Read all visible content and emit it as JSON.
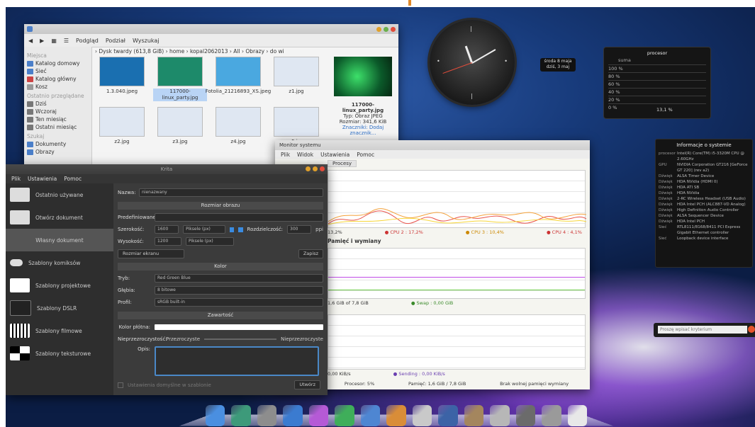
{
  "desktop": {
    "accent": "#e08a2a"
  },
  "file_manager": {
    "toolbar": [
      "Wstecz",
      "Dalej",
      "Podgląd",
      "Podział",
      "Wyszukaj"
    ],
    "sidebar": {
      "places_title": "Miejsca",
      "places": [
        "Katalog domowy",
        "Sieć",
        "Katalog główny",
        "Kosz"
      ],
      "recent_title": "Ostatnio przeglądane",
      "recent": [
        "Dziś",
        "Wczoraj",
        "Ten miesiąc",
        "Ostatni miesiąc"
      ],
      "search_title": "Szukaj",
      "search": [
        "Dokumenty",
        "Obrazy"
      ]
    },
    "breadcrumb": "› Dysk twardy (613,8 GiB) › home › kopal2062013 › All › Obrazy › do wi",
    "thumbs": [
      {
        "name": "1.3.040.jpeg",
        "color": "#1a6fb0"
      },
      {
        "name": "117000-linux_party.jpg",
        "color": "#1d8a6a",
        "selected": true
      },
      {
        "name": "Fotolia_21216893_XS.jpeg",
        "color": "#4aa8e0"
      },
      {
        "name": "z1.jpg",
        "color": "#dfe7f2"
      },
      {
        "name": "z2.jpg",
        "color": "#dfe7f2"
      },
      {
        "name": "z3.jpg",
        "color": "#dfe7f2"
      },
      {
        "name": "z4.jpg",
        "color": "#dfe7f2"
      },
      {
        "name": "z5.jpg",
        "color": "#dfe7f2"
      }
    ],
    "preview": {
      "filename": "117000-linux_party.jpg",
      "type": "Typ: Obraz JPEG",
      "size": "Rozmiar: 341,6 KiB",
      "tag": "Znaczniki: Dodaj znacznik..."
    }
  },
  "clock": {
    "label_line1": "środa 8 maja",
    "label_line2": "dziś, 3 maj"
  },
  "cpu_widget": {
    "title": "procesor",
    "header": "suma",
    "rows": [
      "100 %",
      "80 %",
      "60 %",
      "40 %",
      "20 %",
      "0 %"
    ],
    "value": "13,1 %"
  },
  "sysinfo": {
    "title": "Informacje o systemie",
    "lines": [
      {
        "k": "procesor",
        "v": "Intel(R) Core(TM) i5-3320M CPU @ 2.60GHz"
      },
      {
        "k": "GPU",
        "v": "NVIDIA Corporation GT216 [GeForce GT 220] (rev a2)"
      },
      {
        "k": "Dźwięk",
        "v": "ALSA Timer Device"
      },
      {
        "k": "Dźwięk",
        "v": "HDA NVidia (HDMI 0)"
      },
      {
        "k": "Dźwięk",
        "v": "HDA ATI SB"
      },
      {
        "k": "Dźwięk",
        "v": "HDA NVidia"
      },
      {
        "k": "Dźwięk",
        "v": "2-RC Wireless Headset (USB Audio)"
      },
      {
        "k": "Dźwięk",
        "v": "HDA Intel PCH (ALC887-VD Analog)"
      },
      {
        "k": "Dźwięk",
        "v": "High Definition Audio Controller"
      },
      {
        "k": "Dźwięk",
        "v": "ALSA Sequencer Device"
      },
      {
        "k": "Dźwięk",
        "v": "HDA Intel PCH"
      },
      {
        "k": "Sieć",
        "v": "RTL8111/8168/8411 PCI Express Gigabit Ethernet controller"
      },
      {
        "k": "Sieć",
        "v": "Loopback device interface"
      }
    ]
  },
  "search_widget": {
    "placeholder": "Proszę wpisać kryterium"
  },
  "monitor": {
    "title": "Monitor systemu",
    "menu": [
      "Plik",
      "Widok",
      "Ustawienia",
      "Pomoc"
    ],
    "tab": "Procesy",
    "cpu_legend": [
      "13,2%",
      "● CPU 2 : 17,2%",
      "● CPU 3 : 10,4%",
      "● CPU 4 : 4,1%"
    ],
    "mem_title": "Pamięć i wymiany",
    "mem_legend": [
      "1,6 GiB of 7,8 GiB",
      "● Swap : 0,00 GiB"
    ],
    "net_legend": [
      "0,00 KiB/s",
      "● Sending : 0,00 KiB/s"
    ],
    "status": [
      "Procesor: 5%",
      "Pamięć: 1,6 GiB / 7,8 GiB",
      "Brak wolnej pamięci wymiany"
    ],
    "colors": {
      "cpu1": "#e8524a",
      "cpu2": "#f4a13a",
      "cpu3": "#f7d63a",
      "mem": "#c04ce6",
      "swap": "#6acb44",
      "net": "#8a5fd0"
    }
  },
  "dialog": {
    "title": "Krita",
    "menu": [
      "Plik",
      "Ustawienia",
      "Pomoc"
    ],
    "sidebar": [
      "Ostatnio używane",
      "Otwórz dokument",
      "Własny dokument",
      "Szablony komiksów",
      "Szablony projektowe",
      "Szablony DSLR",
      "Szablony filmowe",
      "Szablony teksturowe"
    ],
    "name_label": "Nazwa:",
    "name_value": "nienazwany",
    "size_section": "Rozmiar obrazu",
    "predefined": "Predefiniowane:",
    "width_label": "Szerokość:",
    "width_value": "1600",
    "height_label": "Wysokość:",
    "height_value": "1200",
    "unit": "Piksele (px)",
    "resolution_label": "Rozdzielczość:",
    "resolution_value": "300",
    "ppi": "ppi",
    "screen_size": "Rozmiar ekranu",
    "save_small": "Zapisz",
    "color_section": "Kolor",
    "mode_label": "Tryb:",
    "mode_value": "Red Green Blue",
    "depth_label": "Głębia:",
    "depth_value": "8 bitowe",
    "profile_label": "Profil:",
    "profile_value": "sRGB built-in",
    "content_section": "Zawartość",
    "bg_label": "Kolor płótna:",
    "opacity_label": "Nieprzezroczystość:",
    "opacity_left": "Przezroczyste",
    "opacity_right": "Nieprzezroczyste",
    "desc_label": "Opis:",
    "default_check": "Ustawienia domyślne w szablonie",
    "create_button": "Utwórz"
  },
  "dock": [
    {
      "name": "finder-icon",
      "color": "#4a8fe0"
    },
    {
      "name": "time-machine-icon",
      "color": "#3d9a7a"
    },
    {
      "name": "system-prefs-icon",
      "color": "#8d8d8d"
    },
    {
      "name": "browser-icon",
      "color": "#3b7bd0"
    },
    {
      "name": "colors-icon",
      "color": "#b55ad6"
    },
    {
      "name": "document-icon",
      "color": "#3fae5a"
    },
    {
      "name": "writer-icon",
      "color": "#4e86d2"
    },
    {
      "name": "guitar-icon",
      "color": "#d98d38"
    },
    {
      "name": "disc-icon",
      "color": "#c9c9c9"
    },
    {
      "name": "photo-icon",
      "color": "#3c63a6"
    },
    {
      "name": "installer-icon",
      "color": "#a4865e"
    },
    {
      "name": "satellite-icon",
      "color": "#b7b7b7"
    },
    {
      "name": "stack-icon",
      "color": "#6b6b6b"
    },
    {
      "name": "trash-icon",
      "color": "#9a9a9a"
    },
    {
      "name": "file-icon",
      "color": "#e8e8e8"
    }
  ]
}
